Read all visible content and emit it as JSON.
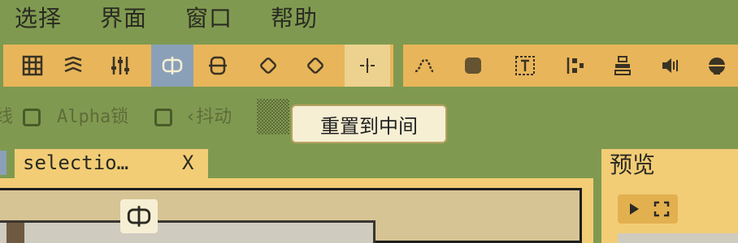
{
  "menu": {
    "items": [
      {
        "label": "选择"
      },
      {
        "label": "界面"
      },
      {
        "label": "窗口"
      },
      {
        "label": "帮助"
      }
    ]
  },
  "toolbar": {
    "left_group_icons": [
      "grid-icon",
      "wave-transform-icon",
      "sliders-icon",
      "center-icon",
      "rounded-rect-icon",
      "rotate-ccw-icon",
      "rotate-cw-icon",
      "split-icon"
    ],
    "right_group_icons": [
      "curve-icon",
      "dither-icon",
      "text-frame-icon",
      "align-icon",
      "stack-icon",
      "speaker-icon",
      "sphere-icon"
    ],
    "active_icon": "center-icon",
    "hover_icon": "split-icon"
  },
  "options": {
    "partial_label": "线",
    "alpha_lock_label": "Alpha锁",
    "jitter_label": "‹抖动",
    "tooltip": "重置到中间"
  },
  "tabs": [
    {
      "label": "selectio…",
      "close": "X"
    }
  ],
  "preview": {
    "title": "预览"
  },
  "colors": {
    "background": "#7f9a50",
    "toolbar": "#e8b55a",
    "panel": "#f2cd75",
    "active": "#8aa0b9"
  }
}
